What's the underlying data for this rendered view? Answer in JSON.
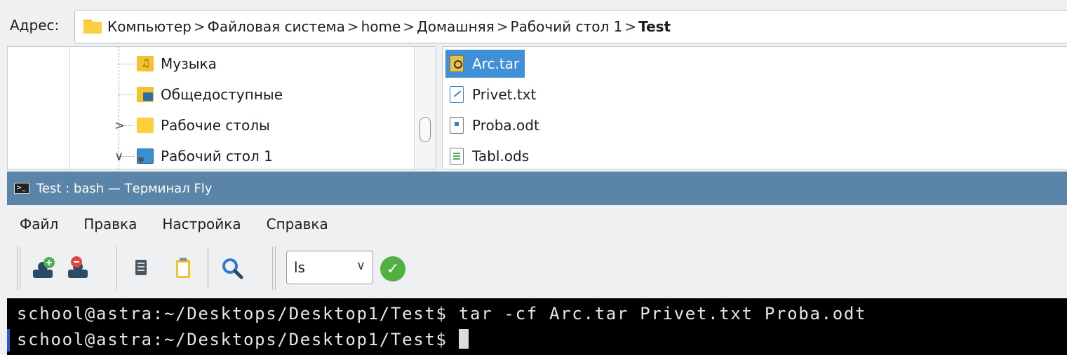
{
  "address_bar": {
    "label": "Адрес:",
    "crumbs": [
      "Компьютер",
      "Файловая система",
      "home",
      "Домашняя",
      "Рабочий стол 1"
    ],
    "current": "Test",
    "separator": ">"
  },
  "tree": {
    "items": [
      {
        "label": "Музыка",
        "icon": "music-folder-icon"
      },
      {
        "label": "Общедоступные",
        "icon": "public-folder-icon"
      },
      {
        "label": "Рабочие столы",
        "icon": "folder-icon",
        "expander": ">"
      },
      {
        "label": "Рабочий стол 1",
        "icon": "desktop-folder-icon",
        "expander": "∨"
      }
    ]
  },
  "files": {
    "items": [
      {
        "name": "Arc.tar",
        "icon": "archive-icon",
        "selected": true
      },
      {
        "name": "Privet.txt",
        "icon": "text-file-icon",
        "selected": false
      },
      {
        "name": "Proba.odt",
        "icon": "document-file-icon",
        "selected": false
      },
      {
        "name": "Tabl.ods",
        "icon": "spreadsheet-file-icon",
        "selected": false
      }
    ]
  },
  "terminal_window": {
    "title": "Test : bash — Терминал Fly",
    "menu": [
      "Файл",
      "Правка",
      "Настройка",
      "Справка"
    ],
    "toolbar": {
      "command_select_value": "ls",
      "icons": [
        "new-session-icon",
        "close-session-icon",
        "copy-icon",
        "paste-icon",
        "search-icon",
        "run-check-icon"
      ]
    },
    "lines": [
      "school@astra:~/Desktops/Desktop1/Test$ tar -cf Arc.tar Privet.txt Proba.odt",
      "school@astra:~/Desktops/Desktop1/Test$ "
    ]
  },
  "colors": {
    "selection": "#3f8fd9",
    "titlebar": "#5a85a8",
    "terminal_bg": "#000000",
    "run_button": "#52b043"
  }
}
